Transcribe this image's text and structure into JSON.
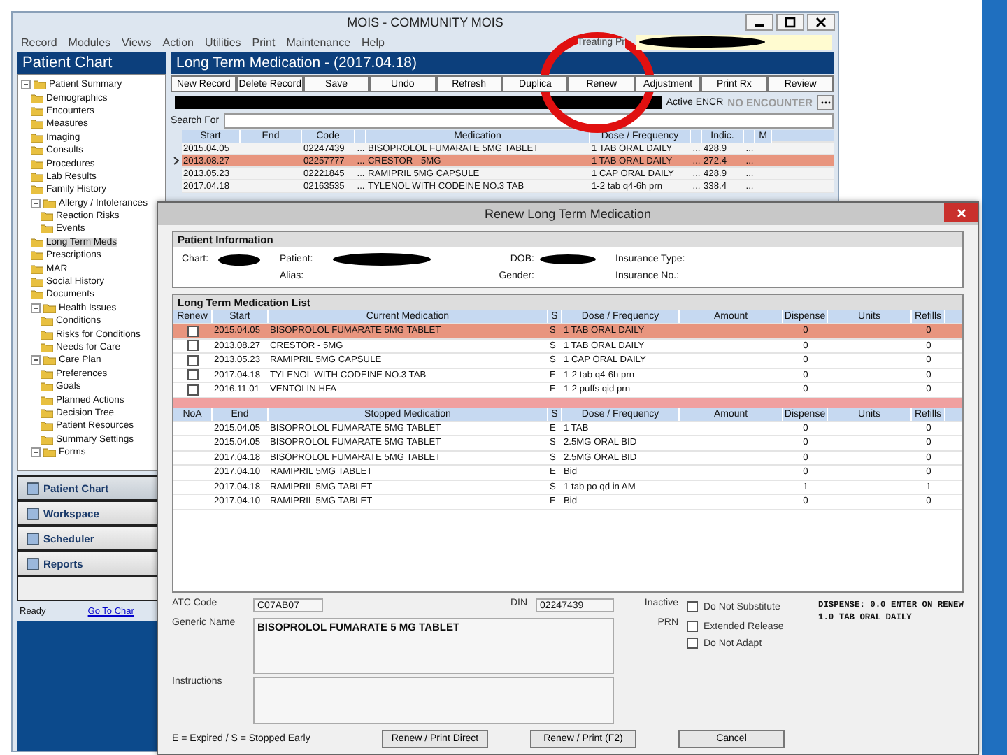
{
  "window": {
    "title": "MOIS - COMMUNITY MOIS",
    "menu": [
      "Record",
      "Modules",
      "Views",
      "Action",
      "Utilities",
      "Print",
      "Maintenance",
      "Help"
    ],
    "provider_label": "Treating Pr"
  },
  "sidebar": {
    "title": "Patient Chart",
    "tree": [
      {
        "label": "Patient Summary",
        "expanded": true,
        "selected": false,
        "children": [
          {
            "label": "Demographics",
            "selected": false
          },
          {
            "label": "Encounters",
            "selected": false
          },
          {
            "label": "Measures",
            "selected": false
          },
          {
            "label": "Imaging",
            "selected": false
          },
          {
            "label": "Consults",
            "selected": false
          },
          {
            "label": "Procedures",
            "selected": false
          },
          {
            "label": "Lab Results",
            "selected": false
          },
          {
            "label": "Family History",
            "selected": false
          },
          {
            "label": "Allergy / Intolerances",
            "expanded": true,
            "selected": false,
            "children": [
              {
                "label": "Reaction Risks",
                "selected": false
              },
              {
                "label": "Events",
                "selected": false
              }
            ]
          },
          {
            "label": "Long Term Meds",
            "selected": true
          },
          {
            "label": "Prescriptions",
            "selected": false
          },
          {
            "label": "MAR",
            "selected": false
          },
          {
            "label": "Social History",
            "selected": false
          },
          {
            "label": "Documents",
            "selected": false
          },
          {
            "label": "Health Issues",
            "expanded": true,
            "selected": false,
            "children": [
              {
                "label": "Conditions",
                "selected": false
              },
              {
                "label": "Risks for Conditions",
                "selected": false
              },
              {
                "label": "Needs for Care",
                "selected": false
              }
            ]
          },
          {
            "label": "Care Plan",
            "expanded": true,
            "selected": false,
            "children": [
              {
                "label": "Preferences",
                "selected": false
              },
              {
                "label": "Goals",
                "selected": false
              },
              {
                "label": "Planned Actions",
                "selected": false
              },
              {
                "label": "Decision Tree",
                "selected": false
              },
              {
                "label": "Patient Resources",
                "selected": false
              },
              {
                "label": "Summary Settings",
                "selected": false
              }
            ]
          },
          {
            "label": "Forms",
            "expanded": true,
            "selected": false
          }
        ]
      }
    ],
    "nav": [
      {
        "label": "Patient Chart",
        "selected": true
      },
      {
        "label": "Workspace",
        "selected": false
      },
      {
        "label": "Scheduler",
        "selected": false
      },
      {
        "label": "Reports",
        "selected": false
      }
    ],
    "status": "Ready",
    "link": "Go To Char"
  },
  "main": {
    "title": "Long Term Medication - (2017.04.18)",
    "toolbar": [
      "New Record",
      "Delete Record",
      "Save",
      "Undo",
      "Refresh",
      "Duplica",
      "Renew",
      "Adjustment",
      "Print Rx",
      "Review"
    ],
    "encounter_label": "Active ENCR",
    "encounter": "NO ENCOUNTER",
    "search_label": "Search For",
    "columns": [
      "Start",
      "End",
      "Code",
      "",
      "Medication",
      "Dose / Frequency",
      "",
      "Indic.",
      "",
      "M"
    ],
    "rows": [
      {
        "selected": false,
        "cells": [
          "2015.04.05",
          "",
          "02247439",
          "...",
          "BISOPROLOL FUMARATE 5MG TABLET",
          "1 TAB ORAL DAILY",
          "...",
          "428.9",
          "...",
          ""
        ]
      },
      {
        "selected": true,
        "cells": [
          "2013.08.27",
          "",
          "02257777",
          "...",
          "CRESTOR - 5MG",
          "1 TAB ORAL DAILY",
          "...",
          "272.4",
          "...",
          ""
        ]
      },
      {
        "selected": false,
        "cells": [
          "2013.05.23",
          "",
          "02221845",
          "...",
          "RAMIPRIL 5MG CAPSULE",
          "1 CAP ORAL DAILY",
          "...",
          "428.9",
          "...",
          ""
        ]
      },
      {
        "selected": false,
        "cells": [
          "2017.04.18",
          "",
          "02163535",
          "...",
          "TYLENOL WITH CODEINE NO.3 TAB",
          "1-2 tab q4-6h prn",
          "...",
          "338.4",
          "...",
          ""
        ]
      }
    ]
  },
  "dialog": {
    "title": "Renew Long Term Medication",
    "patient_section": "Patient Information",
    "patient_fields": [
      "Chart:",
      "Patient:",
      "DOB:",
      "Insurance Type:",
      "Alias:",
      "Gender:",
      "Insurance No.:"
    ],
    "list_section": "Long Term Medication List",
    "current_columns": [
      "Renew",
      "Start",
      "Current Medication",
      "S",
      "Dose / Frequency",
      "Amount",
      "Dispense",
      "Units",
      "Refills"
    ],
    "current_rows": [
      {
        "checked": false,
        "selected": true,
        "cells": [
          "2015.04.05",
          "BISOPROLOL FUMARATE 5MG TABLET",
          "S",
          "1 TAB ORAL DAILY",
          "",
          "0",
          "",
          "0"
        ]
      },
      {
        "checked": false,
        "selected": false,
        "cells": [
          "2013.08.27",
          "CRESTOR - 5MG",
          "S",
          "1 TAB ORAL DAILY",
          "",
          "0",
          "",
          "0"
        ]
      },
      {
        "checked": false,
        "selected": false,
        "cells": [
          "2013.05.23",
          "RAMIPRIL 5MG CAPSULE",
          "S",
          "1 CAP ORAL DAILY",
          "",
          "0",
          "",
          "0"
        ]
      },
      {
        "checked": false,
        "selected": false,
        "cells": [
          "2017.04.18",
          "TYLENOL WITH CODEINE NO.3 TAB",
          "E",
          "1-2 tab q4-6h prn",
          "",
          "0",
          "",
          "0"
        ]
      },
      {
        "checked": false,
        "selected": false,
        "cells": [
          "2016.11.01",
          "VENTOLIN HFA",
          "E",
          "1-2 puffs qid prn",
          "",
          "0",
          "",
          "0"
        ]
      }
    ],
    "stopped_columns": [
      "NoA",
      "End",
      "Stopped Medication",
      "S",
      "Dose / Frequency",
      "Amount",
      "Dispense",
      "Units",
      "Refills"
    ],
    "stopped_rows": [
      [
        "",
        "2015.04.05",
        "BISOPROLOL FUMARATE 5MG TABLET",
        "E",
        "1 TAB",
        "",
        "0",
        "",
        "0"
      ],
      [
        "",
        "2015.04.05",
        "BISOPROLOL FUMARATE 5MG TABLET",
        "S",
        "2.5MG ORAL BID",
        "",
        "0",
        "",
        "0"
      ],
      [
        "",
        "2017.04.18",
        "BISOPROLOL FUMARATE 5MG TABLET",
        "S",
        "2.5MG ORAL BID",
        "",
        "0",
        "",
        "0"
      ],
      [
        "",
        "2017.04.10",
        "RAMIPRIL 5MG TABLET",
        "E",
        "Bid",
        "",
        "0",
        "",
        "0"
      ],
      [
        "",
        "2017.04.18",
        "RAMIPRIL 5MG TABLET",
        "S",
        "1 tab po qd in AM",
        "",
        "1",
        "",
        "1"
      ],
      [
        "",
        "2017.04.10",
        "RAMIPRIL 5MG TABLET",
        "E",
        "Bid",
        "",
        "0",
        "",
        "0"
      ]
    ],
    "atc_label": "ATC Code",
    "atc": "C07AB07",
    "din_label": "DIN",
    "din": "02247439",
    "generic_label": "Generic Name",
    "generic": "BISOPROLOL FUMARATE 5 MG TABLET",
    "instructions_label": "Instructions",
    "flag_labels": [
      "Inactive",
      "PRN"
    ],
    "options": [
      {
        "label": "Do Not Substitute",
        "checked": false
      },
      {
        "label": "Extended Release",
        "checked": false
      },
      {
        "label": "Do Not Adapt",
        "checked": false
      }
    ],
    "notes": [
      "DISPENSE: 0.0 ENTER ON RENEW",
      "1.0 TAB ORAL DAILY"
    ],
    "legend": "E = Expired / S = Stopped Early",
    "buttons": [
      "Renew / Print Direct",
      "Renew / Print (F2)",
      "Cancel"
    ]
  }
}
